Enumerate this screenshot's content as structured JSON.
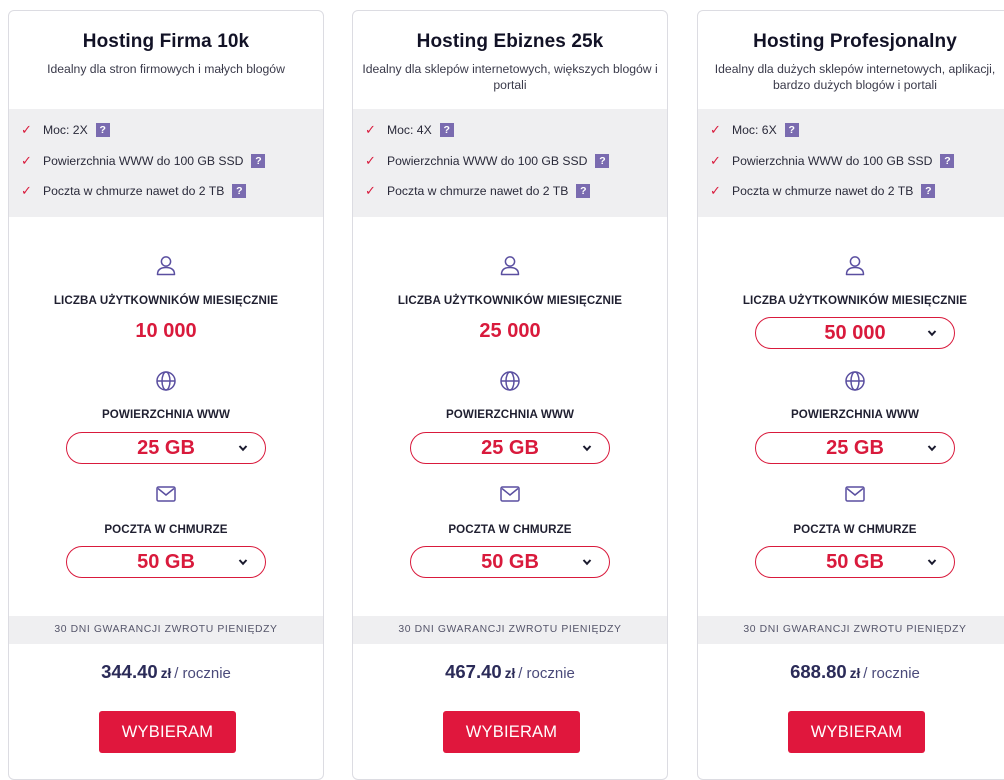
{
  "plans": [
    {
      "title": "Hosting Firma 10k",
      "subtitle": "Idealny dla stron firmowych i małych blogów",
      "features": [
        "Moc: 2X",
        "Powierzchnia WWW do 100 GB SSD",
        "Poczta w chmurze nawet do 2 TB"
      ],
      "help_icon": "?",
      "users_label": "LICZBA UŻYTKOWNIKÓW MIESIĘCZNIE",
      "users_value": "10 000",
      "www_label": "POWIERZCHNIA WWW",
      "www_value": "25 GB",
      "mail_label": "POCZTA W CHMURZE",
      "mail_value": "50 GB",
      "guarantee": "30 DNI GWARANCJI ZWROTU PIENIĘDZY",
      "price": "344.40",
      "currency": "zł",
      "period": "/ rocznie",
      "cta": "WYBIERAM"
    },
    {
      "title": "Hosting Ebiznes 25k",
      "subtitle": "Idealny dla sklepów internetowych, większych blogów i portali",
      "features": [
        "Moc: 4X",
        "Powierzchnia WWW do 100 GB SSD",
        "Poczta w chmurze nawet do 2 TB"
      ],
      "help_icon": "?",
      "users_label": "LICZBA UŻYTKOWNIKÓW MIESIĘCZNIE",
      "users_value": "25 000",
      "www_label": "POWIERZCHNIA WWW",
      "www_value": "25 GB",
      "mail_label": "POCZTA W CHMURZE",
      "mail_value": "50 GB",
      "guarantee": "30 DNI GWARANCJI ZWROTU PIENIĘDZY",
      "price": "467.40",
      "currency": "zł",
      "period": "/ rocznie",
      "cta": "WYBIERAM"
    },
    {
      "title": "Hosting Profesjonalny",
      "subtitle": "Idealny dla dużych sklepów internetowych, aplikacji, bardzo dużych blogów i portali",
      "features": [
        "Moc: 6X",
        "Powierzchnia WWW do 100 GB SSD",
        "Poczta w chmurze nawet do 2 TB"
      ],
      "help_icon": "?",
      "users_label": "LICZBA UŻYTKOWNIKÓW MIESIĘCZNIE",
      "users_value": "50 000",
      "www_label": "POWIERZCHNIA WWW",
      "www_value": "25 GB",
      "mail_label": "POCZTA W CHMURZE",
      "mail_value": "50 GB",
      "guarantee": "30 DNI GWARANCJI ZWROTU PIENIĘDZY",
      "price": "688.80",
      "currency": "zł",
      "period": "/ rocznie",
      "cta": "WYBIERAM"
    }
  ],
  "icons": {
    "check": "check-icon",
    "help": "question-icon",
    "users": "user-icon",
    "www": "globe-icon",
    "mail": "mail-icon",
    "dropdown": "chevron-down-icon"
  },
  "colors": {
    "accent": "#e0173d",
    "value_red": "#d91a3c",
    "help_icon_bg": "#7a6bb0",
    "price_navy": "#2b2b58",
    "panel_gray": "#efeff1"
  }
}
